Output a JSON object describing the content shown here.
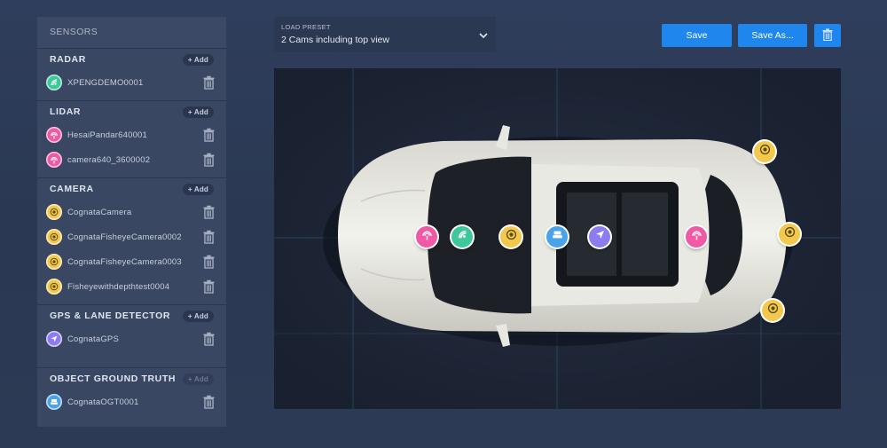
{
  "sidebar": {
    "header": "SENSORS",
    "add_label": "+ Add",
    "sections": [
      {
        "title": "RADAR",
        "items": [
          {
            "name": "XPENGDEMO0001",
            "icon": "radar-icon",
            "color": "#3ec79a"
          }
        ]
      },
      {
        "title": "LIDAR",
        "items": [
          {
            "name": "HesaiPandar640001",
            "icon": "lidar-icon",
            "color": "#f05aa5"
          },
          {
            "name": "camera640_3600002",
            "icon": "lidar-icon",
            "color": "#f05aa5"
          }
        ]
      },
      {
        "title": "CAMERA",
        "items": [
          {
            "name": "CognataCamera",
            "icon": "camera-icon",
            "color": "#f2c94c"
          },
          {
            "name": "CognataFisheyeCamera0002",
            "icon": "camera-icon",
            "color": "#f2c94c"
          },
          {
            "name": "CognataFisheyeCamera0003",
            "icon": "camera-icon",
            "color": "#f2c94c"
          },
          {
            "name": "Fisheyewithdepthtest0004",
            "icon": "camera-icon",
            "color": "#f2c94c"
          }
        ]
      },
      {
        "title": "GPS & LANE DETECTOR",
        "items": [
          {
            "name": "CognataGPS",
            "icon": "gps-icon",
            "color": "#8c7cf0"
          }
        ]
      },
      {
        "title": "OBJECT GROUND TRUTH",
        "add_disabled": true,
        "items": [
          {
            "name": "CognataOGT0001",
            "icon": "ogt-icon",
            "color": "#4aa3e8"
          }
        ]
      }
    ]
  },
  "preset": {
    "label": "LOAD PRESET",
    "value": "2 Cams including top view"
  },
  "toolbar": {
    "save_label": "Save",
    "save_as_label": "Save As..."
  },
  "colors": {
    "accent": "#1f86ee",
    "radar": "#3ec79a",
    "lidar": "#f05aa5",
    "camera": "#f2c94c",
    "gps": "#8c7cf0",
    "ogt": "#4aa3e8"
  },
  "viewport_markers": [
    {
      "type": "lidar",
      "icon": "lidar-icon"
    },
    {
      "type": "radar",
      "icon": "radar-icon"
    },
    {
      "type": "camera",
      "icon": "camera-icon"
    },
    {
      "type": "ogt",
      "icon": "ogt-icon"
    },
    {
      "type": "gps",
      "icon": "gps-icon"
    },
    {
      "type": "lidar",
      "icon": "lidar-icon"
    },
    {
      "type": "camera",
      "icon": "camera-icon"
    },
    {
      "type": "camera",
      "icon": "camera-icon"
    },
    {
      "type": "camera",
      "icon": "camera-icon"
    }
  ]
}
